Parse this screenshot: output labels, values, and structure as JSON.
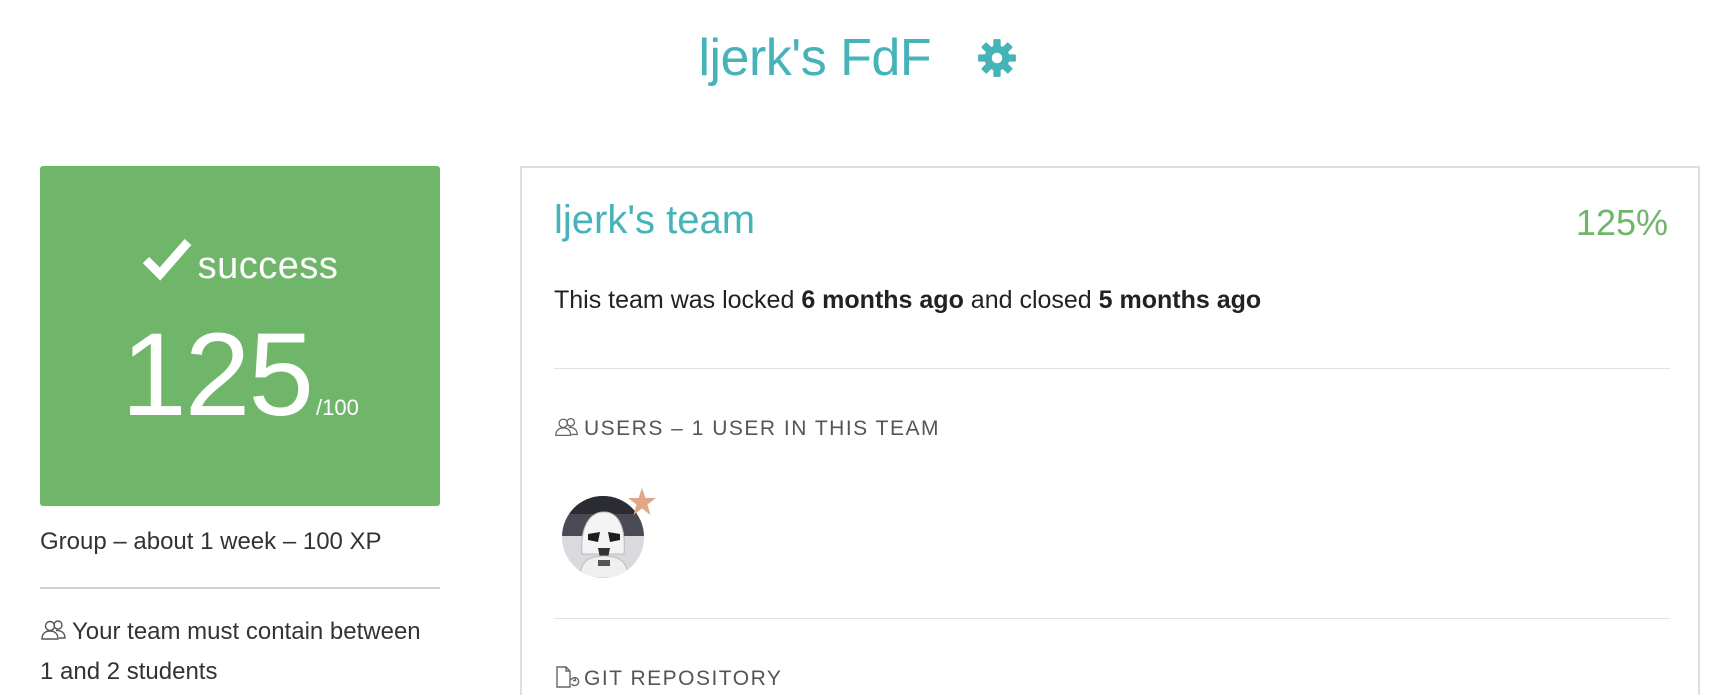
{
  "header": {
    "title": "ljerk's FdF",
    "settings_icon": "gear-icon"
  },
  "status_card": {
    "status_icon": "check-icon",
    "status_label": "success",
    "score": "125",
    "score_max": "/100",
    "color": "#6fb66a"
  },
  "project_info": {
    "meta": "Group – about 1 week – 100 XP",
    "team_rule_icon": "users-icon",
    "team_rule": "Your team must contain between 1 and 2 students"
  },
  "team": {
    "name": "ljerk's team",
    "percent": "125%",
    "status_prefix": "This team was locked ",
    "locked_ago": "6 months ago",
    "status_middle": " and closed ",
    "closed_ago": "5 months ago",
    "users_section": {
      "icon": "users-icon",
      "heading": "USERS – 1 USER IN THIS TEAM",
      "members": [
        {
          "avatar": "stormtrooper-avatar",
          "badge_icon": "leader-star-icon"
        }
      ]
    },
    "git_section": {
      "icon": "git-file-icon",
      "heading": "GIT REPOSITORY"
    }
  },
  "colors": {
    "accent": "#45b3b8",
    "success": "#6fb66a",
    "star": "#e2a789"
  }
}
